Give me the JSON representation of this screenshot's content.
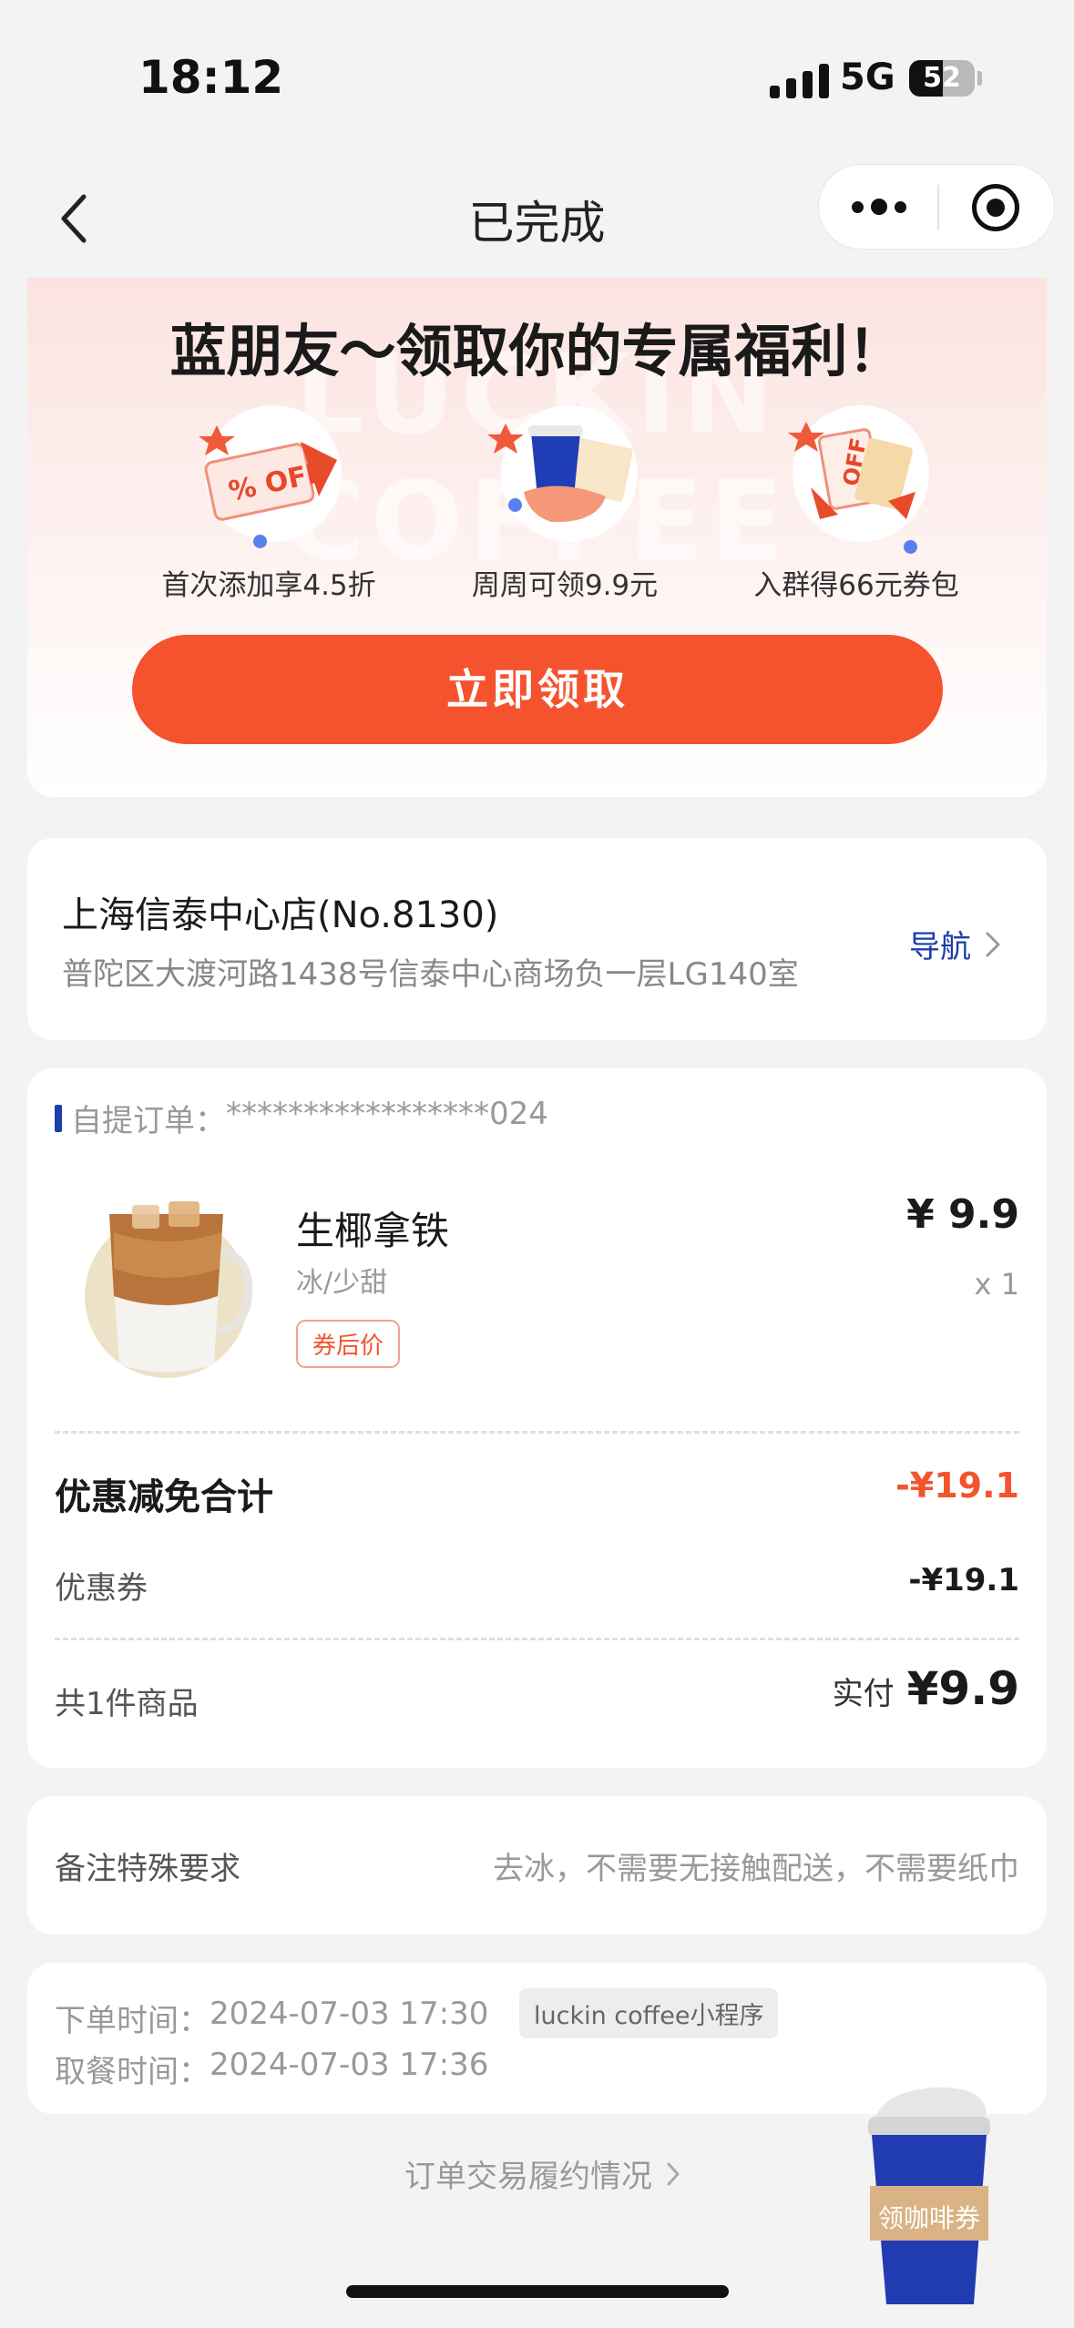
{
  "status_bar": {
    "time": "18:12",
    "network": "5G",
    "battery": "52",
    "battery_level": 0.52
  },
  "nav": {
    "title": "已完成"
  },
  "banner": {
    "watermark": "LUCKIN COFFEE",
    "title": "蓝朋友～领取你的专属福利！",
    "benefits": [
      {
        "label": "首次添加享4.5折",
        "icon": "off-coupon-icon",
        "art_text": "% OFF"
      },
      {
        "label": "周周可领9.9元",
        "icon": "coffee-cup-coupon-icon"
      },
      {
        "label": "入群得66元券包",
        "icon": "coupon-pack-icon",
        "art_text": "OFF"
      }
    ],
    "cta": "立即领取"
  },
  "store": {
    "name": "上海信泰中心店(No.8130)",
    "address": "普陀区大渡河路1438号信泰中心商场负一层LG140室",
    "nav_label": "导航"
  },
  "order": {
    "type_label": "自提订单：",
    "order_no": "*****************024",
    "item": {
      "name": "生椰拿铁",
      "spec": "冰/少甜",
      "tag": "券后价",
      "price": "¥ 9.9",
      "qty": "x 1"
    },
    "discount_total_label": "优惠减免合计",
    "discount_total_value": "-¥19.1",
    "coupon_label": "优惠券",
    "coupon_value": "-¥19.1",
    "count_label": "共1件商品",
    "paid_label": "实付",
    "paid_value": "¥9.9"
  },
  "remark": {
    "label": "备注特殊要求",
    "value": "去冰，不需要无接触配送，不需要纸巾"
  },
  "times": {
    "order_label": "下单时间：",
    "order_time": "2024-07-03 17:30",
    "channel": "luckin coffee小程序",
    "pickup_label": "取餐时间：",
    "pickup_time": "2024-07-03 17:36"
  },
  "footer": {
    "fulfillment_link": "订单交易履约情况",
    "float_button": "领咖啡券"
  },
  "colors": {
    "accent": "#f4532e",
    "brand_blue": "#1b3fa8",
    "page_bg": "#f3f3f3"
  }
}
